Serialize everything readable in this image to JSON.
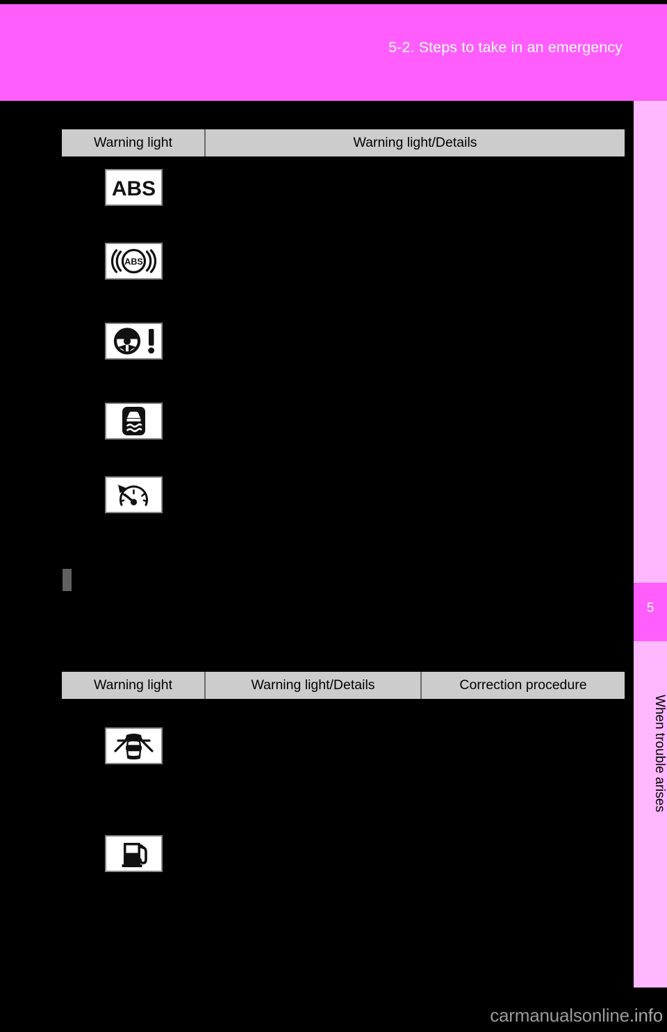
{
  "page": {
    "header_title": "5-2. Steps to take in an emergency",
    "background_color": "#000000",
    "header_color": "#ff5efd",
    "sidebar_color": "#ffb8fd",
    "table_header_color": "#cccccc"
  },
  "sidebar": {
    "chapter_number": "5",
    "chapter_label": "When trouble arises"
  },
  "tables": [
    {
      "id": "table-1",
      "columns": [
        "Warning light",
        "Warning light/Details"
      ],
      "rows": [
        {
          "icon": "abs-text-warning-icon",
          "icon_label": "ABS"
        },
        {
          "icon": "abs-brake-warning-icon",
          "icon_label": "ABS"
        },
        {
          "icon": "power-steering-warning-icon",
          "icon_label": ""
        },
        {
          "icon": "vsc-skid-warning-icon",
          "icon_label": ""
        },
        {
          "icon": "speed-limiter-warning-icon",
          "icon_label": ""
        }
      ]
    },
    {
      "id": "table-2",
      "columns": [
        "Warning light",
        "Warning light/Details",
        "Correction procedure"
      ],
      "rows": [
        {
          "icon": "door-open-warning-icon",
          "icon_label": ""
        },
        {
          "icon": "low-fuel-warning-icon",
          "icon_label": ""
        }
      ]
    }
  ],
  "watermark": {
    "main": "carmanualsonline",
    "suffix": ".info"
  }
}
